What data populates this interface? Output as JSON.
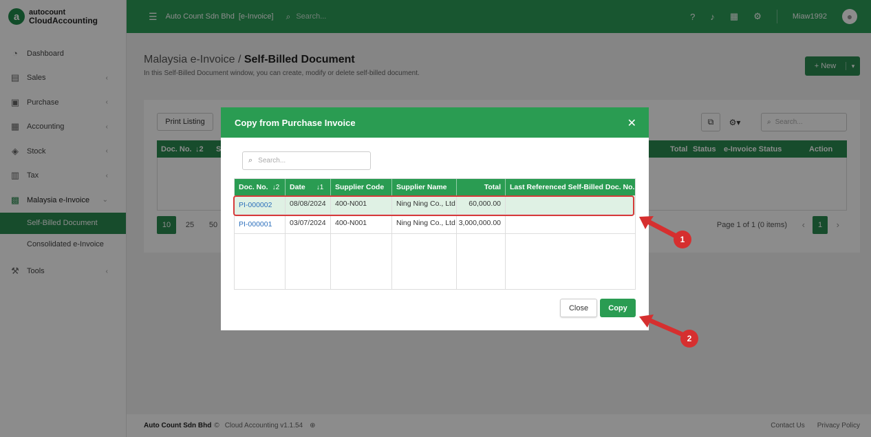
{
  "brand": {
    "top": "autocount",
    "bottom": "CloudAccounting",
    "mark": "a"
  },
  "nav": [
    {
      "label": "Dashboard",
      "icon": "dashboard-icon",
      "chev": ""
    },
    {
      "label": "Sales",
      "icon": "sales-icon",
      "chev": "‹"
    },
    {
      "label": "Purchase",
      "icon": "purchase-icon",
      "chev": "‹"
    },
    {
      "label": "Accounting",
      "icon": "accounting-icon",
      "chev": "‹"
    },
    {
      "label": "Stock",
      "icon": "stock-icon",
      "chev": "‹"
    },
    {
      "label": "Tax",
      "icon": "tax-icon",
      "chev": "‹"
    },
    {
      "label": "Malaysia e-Invoice",
      "icon": "einvoice-icon",
      "chev": "⌄"
    }
  ],
  "subnav": [
    {
      "label": "Self-Billed Document"
    },
    {
      "label": "Consolidated e-Invoice"
    }
  ],
  "tools": {
    "label": "Tools",
    "chev": "‹"
  },
  "topbar": {
    "company": "Auto Count Sdn Bhd",
    "tag": "[e-Invoice]",
    "search_placeholder": "Search...",
    "user": "Miaw1992"
  },
  "page": {
    "title_prefix": "Malaysia e-Invoice / ",
    "title": "Self-Billed Document",
    "desc": "In this Self-Billed Document window, you can create, modify or delete self-billed document.",
    "new_label": "+ New"
  },
  "panel": {
    "print_label": "Print Listing",
    "search_placeholder": "Search...",
    "headers": {
      "doc": "Doc. No.",
      "doc_sort": "↓2",
      "s": "S",
      "total": "Total",
      "status": "Status",
      "einv": "e-Invoice Status",
      "action": "Action"
    },
    "pager": [
      "10",
      "25",
      "50"
    ],
    "page_info": "Page 1 of 1 (0 items)",
    "page_num": "1"
  },
  "modal": {
    "title": "Copy from Purchase Invoice",
    "search_placeholder": "Search...",
    "headers": {
      "doc": "Doc. No.",
      "doc_sort": "↓2",
      "date": "Date",
      "date_sort": "↓1",
      "supcode": "Supplier Code",
      "supname": "Supplier Name",
      "total": "Total",
      "lastref": "Last Referenced Self-Billed Doc. No."
    },
    "rows": [
      {
        "doc": "PI-000002",
        "date": "08/08/2024",
        "supcode": "400-N001",
        "supname": "Ning Ning Co., Ltd",
        "total": "60,000.00",
        "lastref": ""
      },
      {
        "doc": "PI-000001",
        "date": "03/07/2024",
        "supcode": "400-N001",
        "supname": "Ning Ning Co., Ltd",
        "total": "3,000,000.00",
        "lastref": ""
      }
    ],
    "close_label": "Close",
    "copy_label": "Copy"
  },
  "callouts": [
    "1",
    "2"
  ],
  "footer": {
    "brand": "Auto Count Sdn Bhd",
    "copyright": "©",
    "version": "Cloud Accounting v1.1.54",
    "contact": "Contact Us",
    "privacy": "Privacy Policy"
  },
  "colors": {
    "primary": "#2c9d58",
    "accent_red": "#d62f2f",
    "link": "#2a6ebb"
  }
}
